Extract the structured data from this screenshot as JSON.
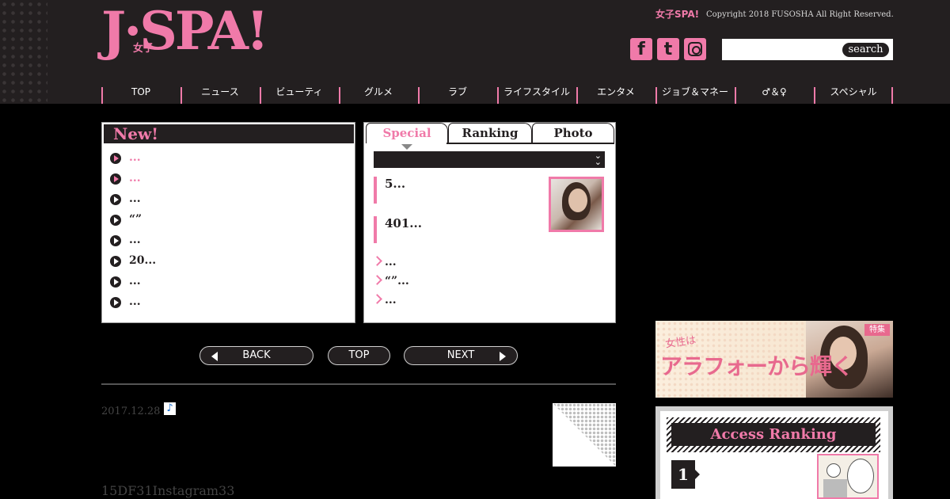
{
  "header": {
    "logo_text": "J·SPA!",
    "logo_sub": "女子",
    "brand_small": "女子SPA!",
    "copyright": "Copyright 2018 FUSOSHA All Right Reserved.",
    "search_label": "search",
    "search_placeholder": "",
    "sns": {
      "facebook": "f",
      "twitter": "t"
    }
  },
  "nav": {
    "items": [
      {
        "label": "TOP"
      },
      {
        "label": "ニュース"
      },
      {
        "label": "ビューティ"
      },
      {
        "label": "グルメ"
      },
      {
        "label": "ラブ"
      },
      {
        "label": "ライフスタイル"
      },
      {
        "label": "エンタメ"
      },
      {
        "label": "ジョブ＆マネー"
      },
      {
        "label": "♂＆♀"
      },
      {
        "label": "スペシャル"
      }
    ],
    "accent_color": "#f07aa9"
  },
  "new_box": {
    "title": "New!",
    "items": [
      {
        "text": "..."
      },
      {
        "text": "..."
      },
      {
        "text": "..."
      },
      {
        "text": "“”"
      },
      {
        "text": "..."
      },
      {
        "text": "20..."
      },
      {
        "text": "..."
      },
      {
        "text": "..."
      }
    ]
  },
  "special_box": {
    "tabs": [
      {
        "label": "Special",
        "active": true
      },
      {
        "label": "Ranking",
        "active": false
      },
      {
        "label": "Photo",
        "active": false
      }
    ],
    "features": [
      {
        "text": "5..."
      },
      {
        "text": "401..."
      }
    ],
    "links": [
      {
        "text": "..."
      },
      {
        "text": "“”..."
      },
      {
        "text": "..."
      }
    ]
  },
  "pager": {
    "back": "BACK",
    "top": "TOP",
    "next": "NEXT"
  },
  "article": {
    "date": "2017.12.28",
    "music_icon": "♪",
    "text": "15DF31Instagram33"
  },
  "sidebar": {
    "banner": {
      "tag": "特集",
      "small": "女性は",
      "big": "アラフォーから輝く"
    },
    "ranking": {
      "title": "Access Ranking",
      "first_rank": "1"
    }
  }
}
